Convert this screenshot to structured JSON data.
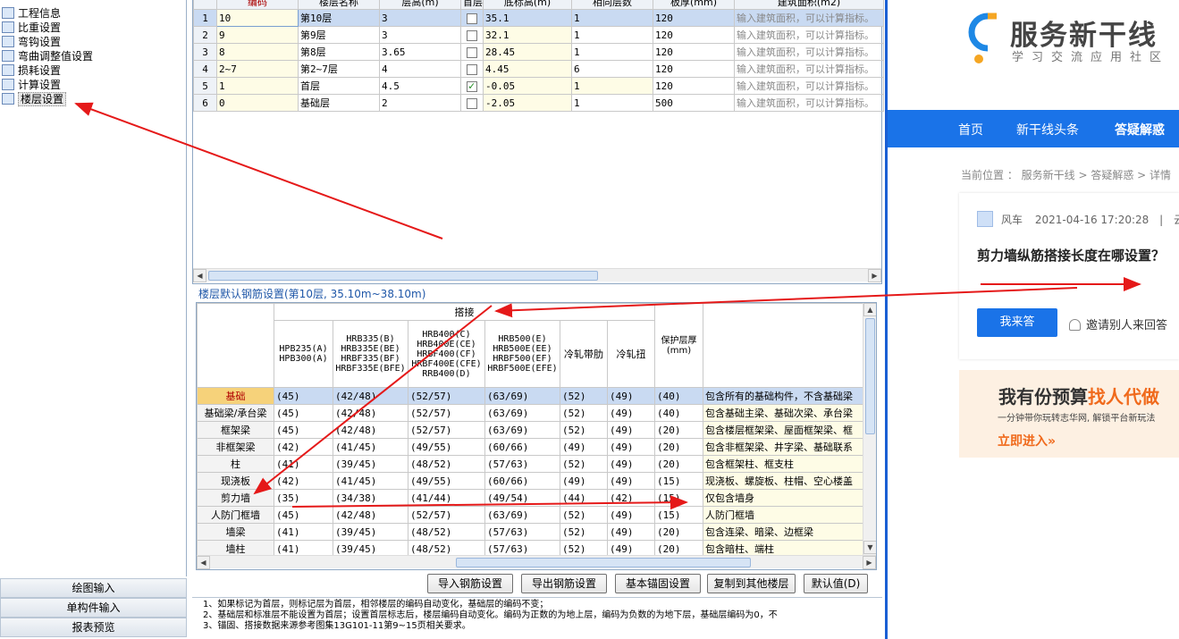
{
  "tree": [
    {
      "label": "工程信息",
      "icon": "project-info-icon"
    },
    {
      "label": "比重设置",
      "icon": "weight-ratio-icon"
    },
    {
      "label": "弯钩设置",
      "icon": "hook-icon"
    },
    {
      "label": "弯曲调整值设置",
      "icon": "bend-adjust-icon"
    },
    {
      "label": "损耗设置",
      "icon": "loss-icon"
    },
    {
      "label": "计算设置",
      "icon": "calc-settings-icon"
    },
    {
      "label": "楼层设置",
      "icon": "floor-settings-icon"
    }
  ],
  "nav_buttons": [
    "绘图输入",
    "单构件输入",
    "报表预览"
  ],
  "floor_table": {
    "headers": [
      "编码",
      "楼层名称",
      "层高(m)",
      "首层",
      "底标高(m)",
      "相同层数",
      "板厚(mm)",
      "建筑面积(m2)"
    ],
    "rows": [
      {
        "n": "1",
        "code": "10",
        "name": "第10层",
        "height": "3",
        "first": false,
        "base": "35.1",
        "same": "1",
        "slab": "120",
        "area": "输入建筑面积，可以计算指标。"
      },
      {
        "n": "2",
        "code": "9",
        "name": "第9层",
        "height": "3",
        "first": false,
        "base": "32.1",
        "same": "1",
        "slab": "120",
        "area": "输入建筑面积，可以计算指标。"
      },
      {
        "n": "3",
        "code": "8",
        "name": "第8层",
        "height": "3.65",
        "first": false,
        "base": "28.45",
        "same": "1",
        "slab": "120",
        "area": "输入建筑面积，可以计算指标。"
      },
      {
        "n": "4",
        "code": "2~7",
        "name": "第2~7层",
        "height": "4",
        "first": false,
        "base": "4.45",
        "same": "6",
        "slab": "120",
        "area": "输入建筑面积，可以计算指标。"
      },
      {
        "n": "5",
        "code": "1",
        "name": "首层",
        "height": "4.5",
        "first": true,
        "base": "-0.05",
        "same": "1",
        "slab": "120",
        "area": "输入建筑面积，可以计算指标。"
      },
      {
        "n": "6",
        "code": "0",
        "name": "基础层",
        "height": "2",
        "first": false,
        "base": "-2.05",
        "same": "1",
        "slab": "500",
        "area": "输入建筑面积，可以计算指标。"
      }
    ]
  },
  "section_title": "楼层默认钢筋设置(第10层, 35.10m~38.10m)",
  "rebar_table": {
    "group_header": "搭接",
    "headers": [
      "HPB235(A)\nHPB300(A)",
      "HRB335(B)\nHRB335E(BE)\nHRBF335(BF)\nHRBF335E(BFE)",
      "HRB400(C)\nHRB400E(CE)\nHRBF400(CF)\nHRBF400E(CFE)\nRRB400(D)",
      "HRB500(E)\nHRB500E(EE)\nHRBF500(EF)\nHRBF500E(EFE)",
      "冷轧带肋",
      "冷轧扭",
      "保护层厚\n(mm)"
    ],
    "rows": [
      {
        "name": "基础",
        "v": [
          "(45)",
          "(42/48)",
          "(52/57)",
          "(63/69)",
          "(52)",
          "(49)",
          "(40)"
        ],
        "desc": "包含所有的基础构件，不含基础梁"
      },
      {
        "name": "基础梁/承台梁",
        "v": [
          "(45)",
          "(42/48)",
          "(52/57)",
          "(63/69)",
          "(52)",
          "(49)",
          "(40)"
        ],
        "desc": "包含基础主梁、基础次梁、承台梁"
      },
      {
        "name": "框架梁",
        "v": [
          "(45)",
          "(42/48)",
          "(52/57)",
          "(63/69)",
          "(52)",
          "(49)",
          "(20)"
        ],
        "desc": "包含楼层框架梁、屋面框架梁、框"
      },
      {
        "name": "非框架梁",
        "v": [
          "(42)",
          "(41/45)",
          "(49/55)",
          "(60/66)",
          "(49)",
          "(49)",
          "(20)"
        ],
        "desc": "包含非框架梁、井字梁、基础联系"
      },
      {
        "name": "柱",
        "v": [
          "(41)",
          "(39/45)",
          "(48/52)",
          "(57/63)",
          "(52)",
          "(49)",
          "(20)"
        ],
        "desc": "包含框架柱、框支柱"
      },
      {
        "name": "现浇板",
        "v": [
          "(42)",
          "(41/45)",
          "(49/55)",
          "(60/66)",
          "(49)",
          "(49)",
          "(15)"
        ],
        "desc": "现浇板、螺旋板、柱帽、空心楼盖"
      },
      {
        "name": "剪力墙",
        "v": [
          "(35)",
          "(34/38)",
          "(41/44)",
          "(49/54)",
          "(44)",
          "(42)",
          "(15)"
        ],
        "desc": "仅包含墙身"
      },
      {
        "name": "人防门框墙",
        "v": [
          "(45)",
          "(42/48)",
          "(52/57)",
          "(63/69)",
          "(52)",
          "(49)",
          "(15)"
        ],
        "desc": "人防门框墙"
      },
      {
        "name": "墙梁",
        "v": [
          "(41)",
          "(39/45)",
          "(48/52)",
          "(57/63)",
          "(52)",
          "(49)",
          "(20)"
        ],
        "desc": "包含连梁、暗梁、边框梁"
      },
      {
        "name": "墙柱",
        "v": [
          "(41)",
          "(39/45)",
          "(48/52)",
          "(57/63)",
          "(52)",
          "(49)",
          "(20)"
        ],
        "desc": "包含暗柱、端柱"
      }
    ]
  },
  "buttons": [
    "导入钢筋设置",
    "导出钢筋设置",
    "基本锚固设置",
    "复制到其他楼层",
    "默认值(D)"
  ],
  "notes": [
    "1、如果标记为首层，则标记层为首层，相邻楼层的编码自动变化，基础层的编码不变；",
    "2、基础层和标准层不能设置为首层；设置首层标志后，楼层编码自动变化。编码为正数的为地上层，编码为负数的为地下层，基础层编码为0，不",
    "3、锚固、搭接数据来源参考图集13G101-11第9~15页相关要求。"
  ],
  "web": {
    "brand": "服务新干线",
    "brand_sub": "学习交流应用社区",
    "nav": [
      "首页",
      "新干线头条",
      "答疑解惑"
    ],
    "crumb": "当前位置 ： 服务新干线 > 答疑解惑 > 详情",
    "author": "风车",
    "date": "2021-04-16 17:20:28",
    "sep": "|",
    "trail": "云",
    "question": "剪力墙纵筋搭接长度在哪设置？",
    "answer_btn": "我来答",
    "invite": "邀请别人来回答",
    "banner_a": "我有份预算",
    "banner_b": "找人代做",
    "banner_sub": "一分钟带你玩转志华网, 解锁平台新玩法",
    "banner_cta": "立即进入»",
    "accent": "#1a73e8"
  },
  "annotation_color": "#e51919"
}
